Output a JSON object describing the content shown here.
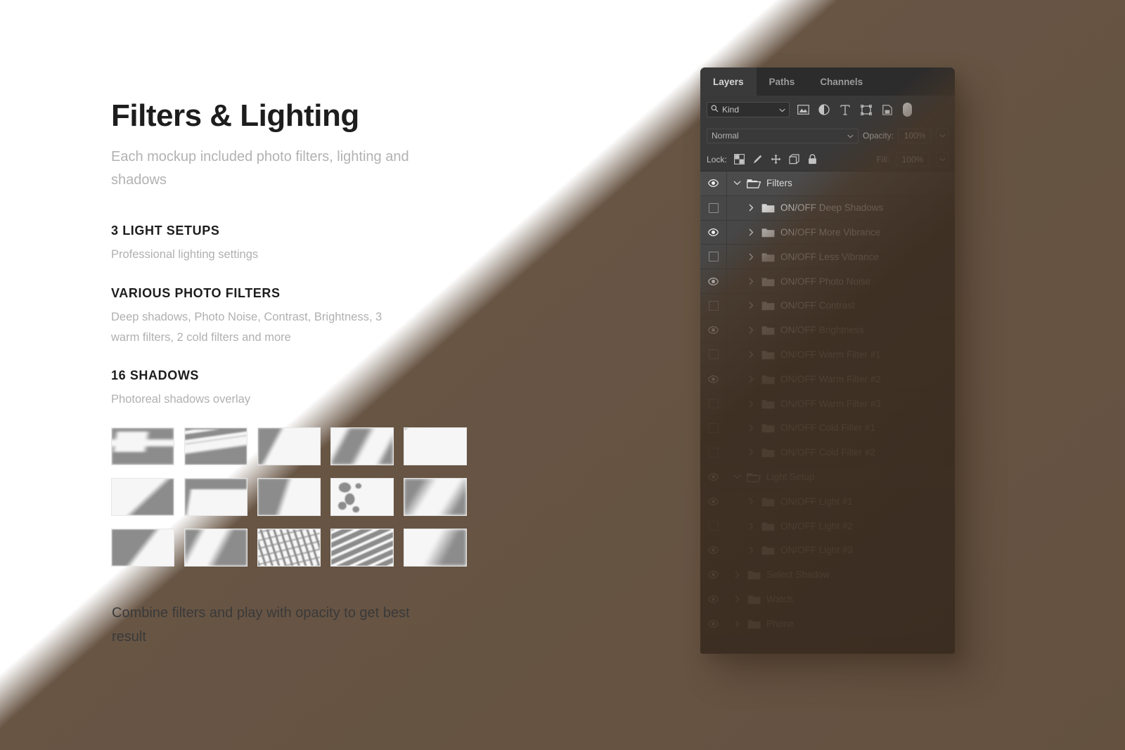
{
  "hero": {
    "title": "Filters & Lighting",
    "subtitle": "Each mockup included photo filters, lighting and shadows"
  },
  "features": [
    {
      "title": "3 LIGHT SETUPS",
      "desc": "Professional lighting settings"
    },
    {
      "title": "VARIOUS PHOTO FILTERS",
      "desc": "Deep shadows, Photo Noise, Contrast, Brightness, 3 warm filters, 2 cold filters and more"
    },
    {
      "title": "16 SHADOWS",
      "desc": "Photoreal shadows overlay"
    }
  ],
  "footer_note": "Combine filters and play with opacity to get best result",
  "thumbnails": [
    {
      "name": "shadow-thumb-window-blur"
    },
    {
      "name": "shadow-thumb-window-slats"
    },
    {
      "name": "shadow-thumb-diagonal-soft"
    },
    {
      "name": "shadow-thumb-light-beam"
    },
    {
      "name": "shadow-thumb-foliage-edge"
    },
    {
      "name": "shadow-thumb-corner-diagonal"
    },
    {
      "name": "shadow-thumb-frame-corner"
    },
    {
      "name": "shadow-thumb-wide-diagonal"
    },
    {
      "name": "shadow-thumb-leaves"
    },
    {
      "name": "shadow-thumb-soft-band"
    },
    {
      "name": "shadow-thumb-triangle"
    },
    {
      "name": "shadow-thumb-double-band"
    },
    {
      "name": "shadow-thumb-blinds-dense"
    },
    {
      "name": "shadow-thumb-blinds-angled"
    },
    {
      "name": "shadow-thumb-faint-diagonal"
    }
  ],
  "panel": {
    "tabs": [
      {
        "label": "Layers",
        "active": true
      },
      {
        "label": "Paths",
        "active": false
      },
      {
        "label": "Channels",
        "active": false
      }
    ],
    "filter_bar": {
      "kind_label": "Kind",
      "icons": [
        "search-icon",
        "pixel-layer-icon",
        "adjustment-layer-icon",
        "type-layer-icon",
        "shape-layer-icon",
        "smart-object-icon",
        "filter-toggle-knob"
      ]
    },
    "blend_row": {
      "blend_mode": "Normal",
      "opacity_label": "Opacity:",
      "opacity_value": "100%"
    },
    "lock_row": {
      "lock_label": "Lock:",
      "icons": [
        "lock-transparent-icon",
        "lock-image-icon",
        "lock-position-icon",
        "lock-artboard-icon",
        "lock-all-icon"
      ],
      "fill_label": "Fill:",
      "fill_value": "100%"
    },
    "layers": [
      {
        "name": "Filters",
        "type": "group",
        "expanded": true,
        "visible": true,
        "indent": 0
      },
      {
        "name": "ON/OFF Deep Shadows",
        "type": "folder",
        "expanded": false,
        "visible": false,
        "indent": 1
      },
      {
        "name": "ON/OFF More Vibrance",
        "type": "folder",
        "expanded": false,
        "visible": true,
        "indent": 1
      },
      {
        "name": "ON/OFF Less Vibrance",
        "type": "folder",
        "expanded": false,
        "visible": false,
        "indent": 1
      },
      {
        "name": "ON/OFF Photo Noise",
        "type": "folder",
        "expanded": false,
        "visible": true,
        "indent": 1
      },
      {
        "name": "ON/OFF Contrast",
        "type": "folder",
        "expanded": false,
        "visible": false,
        "indent": 1
      },
      {
        "name": "ON/OFF Brightness",
        "type": "folder",
        "expanded": false,
        "visible": true,
        "indent": 1
      },
      {
        "name": "ON/OFF Warm Filter #1",
        "type": "folder",
        "expanded": false,
        "visible": false,
        "indent": 1
      },
      {
        "name": "ON/OFF Warm Filter #2",
        "type": "folder",
        "expanded": false,
        "visible": true,
        "indent": 1
      },
      {
        "name": "ON/OFF Warm Filter #3",
        "type": "folder",
        "expanded": false,
        "visible": false,
        "indent": 1
      },
      {
        "name": "ON/OFF Cold Filter #1",
        "type": "folder",
        "expanded": false,
        "visible": false,
        "indent": 1
      },
      {
        "name": "ON/OFF Cold Filter #2",
        "type": "folder",
        "expanded": false,
        "visible": false,
        "indent": 1
      },
      {
        "name": "Light Setup",
        "type": "group",
        "expanded": true,
        "visible": true,
        "indent": 0
      },
      {
        "name": "ON/OFF Light #1",
        "type": "folder",
        "expanded": false,
        "visible": true,
        "indent": 1
      },
      {
        "name": "ON/OFF Light #2",
        "type": "folder",
        "expanded": false,
        "visible": false,
        "indent": 1
      },
      {
        "name": "ON/OFF Light #3",
        "type": "folder",
        "expanded": false,
        "visible": true,
        "indent": 1
      },
      {
        "name": "Select Shadow",
        "type": "folder",
        "expanded": false,
        "visible": true,
        "indent": 0
      },
      {
        "name": "Watch",
        "type": "folder",
        "expanded": false,
        "visible": true,
        "indent": 0
      },
      {
        "name": "Phone",
        "type": "folder",
        "expanded": false,
        "visible": true,
        "indent": 0
      }
    ]
  },
  "colors": {
    "shadow_brown": "#5c4836",
    "panel_bg": "#434343",
    "panel_tabs_bg": "#2c2c2c",
    "row_bg": "#474747",
    "text_light": "#e2e2e2",
    "title_dark": "#1d1d1d",
    "muted_gray": "#b2b2b2"
  }
}
